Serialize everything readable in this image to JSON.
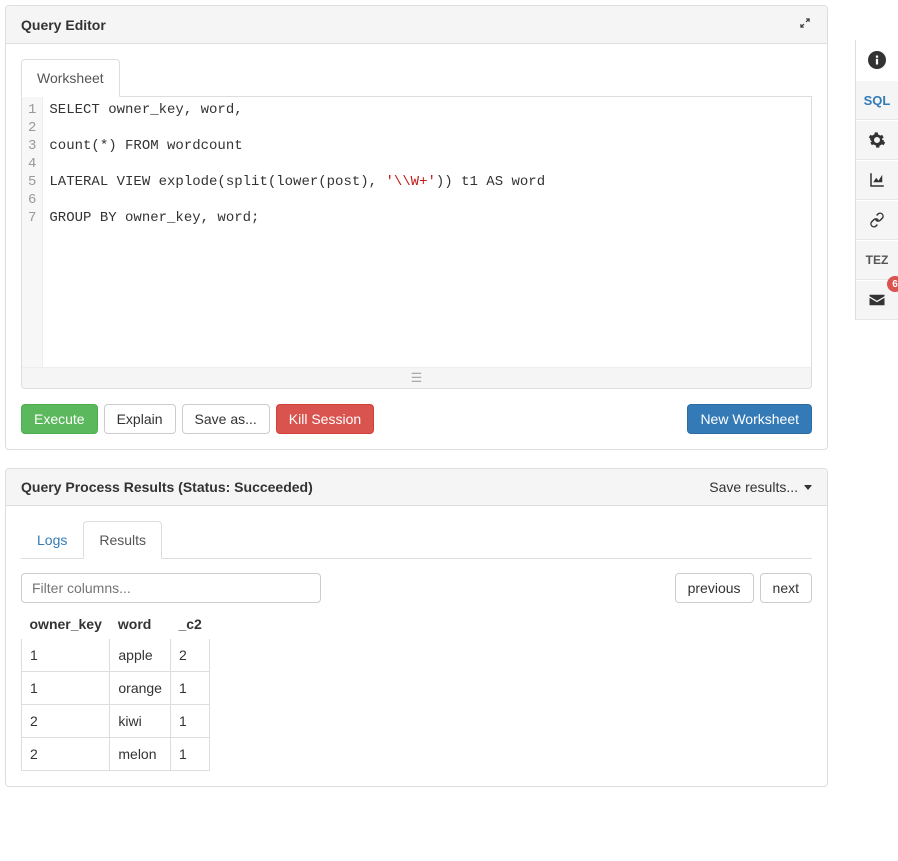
{
  "query_editor": {
    "title": "Query Editor",
    "worksheet_tab": "Worksheet",
    "code_lines": {
      "l1_a": "SELECT owner_key, word,",
      "l3_a": "count(*) FROM wordcount",
      "l5_a": "LATERAL VIEW explode(split(lower(post), ",
      "l5_b": "'\\\\W+'",
      "l5_c": ")) t1 AS word",
      "l7_a": "GROUP BY owner_key, word;"
    },
    "line_numbers": [
      "1",
      "2",
      "3",
      "4",
      "5",
      "6",
      "7"
    ],
    "buttons": {
      "execute": "Execute",
      "explain": "Explain",
      "save_as": "Save as...",
      "kill": "Kill Session",
      "new_worksheet": "New Worksheet"
    }
  },
  "results_panel": {
    "title": "Query Process Results (Status: Succeeded)",
    "save_results": "Save results...",
    "tabs": {
      "logs": "Logs",
      "results": "Results"
    },
    "filter_placeholder": "Filter columns...",
    "pager": {
      "prev": "previous",
      "next": "next"
    },
    "columns": {
      "c0": "owner_key",
      "c1": "word",
      "c2": "_c2"
    },
    "rows": [
      {
        "owner_key": "1",
        "word": "apple",
        "c2": "2"
      },
      {
        "owner_key": "1",
        "word": "orange",
        "c2": "1"
      },
      {
        "owner_key": "2",
        "word": "kiwi",
        "c2": "1"
      },
      {
        "owner_key": "2",
        "word": "melon",
        "c2": "1"
      }
    ]
  },
  "rail": {
    "sql": "SQL",
    "tez": "TEZ",
    "badge": "6"
  }
}
